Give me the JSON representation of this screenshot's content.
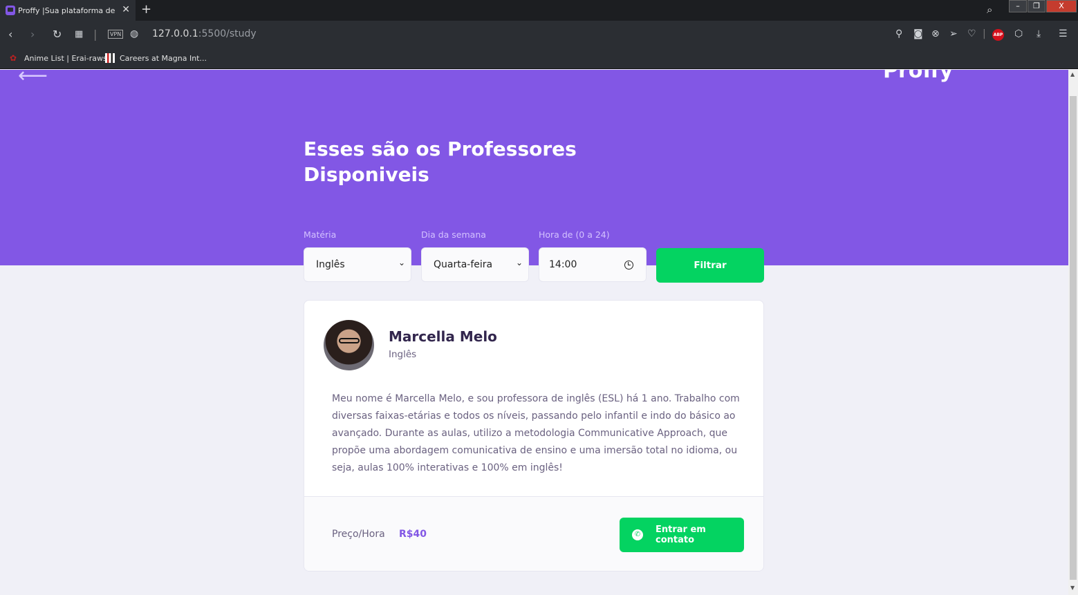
{
  "browser": {
    "tab_title": "Proffy |Sua plataforma de estudos",
    "tab_close": "✕",
    "new_tab": "+",
    "url_host": "127.0.0.1",
    "url_path": ":5500/study",
    "vpn_label": "VPN",
    "abp_label": "ABP",
    "bookmarks": [
      {
        "label": "Anime List | Erai-raws"
      },
      {
        "label": "Careers at Magna Int..."
      }
    ],
    "window_buttons": {
      "minimize": "–",
      "restore": "❐",
      "close": "X"
    }
  },
  "header": {
    "back_arrow": "⟵",
    "logo": "Proffy",
    "title": "Esses são os Professores Disponiveis"
  },
  "filters": {
    "subject": {
      "label": "Matéria",
      "value": "Inglês"
    },
    "weekday": {
      "label": "Dia da semana",
      "value": "Quarta-feira"
    },
    "time": {
      "label": "Hora de (0 a 24)",
      "value": "14:00"
    },
    "submit_label": "Filtrar"
  },
  "teacher": {
    "name": "Marcella Melo",
    "subject": "Inglês",
    "bio": "Meu nome é Marcella Melo, e sou professora de inglês (ESL) há 1 ano. Trabalho com diversas faixas-etárias e todos os níveis, passando pelo infantil e indo do básico ao avançado. Durante as aulas, utilizo a metodologia Communicative Approach, que propõe uma abordagem comunicativa de ensino e uma imersão total no idioma, ou seja, aulas 100% interativas e 100% em inglês!",
    "price_label": "Preço/Hora",
    "price_value": "R$40",
    "contact_label": "Entrar em contato"
  }
}
